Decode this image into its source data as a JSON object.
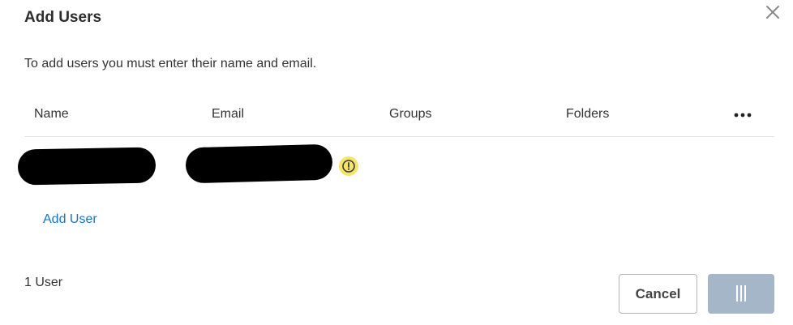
{
  "dialog": {
    "title": "Add Users",
    "instructions": "To add users you must enter their name and email."
  },
  "icons": {
    "close": "close-icon",
    "more": "more-horizontal-icon",
    "warning": "warning-icon",
    "loading": "loading-bars-icon"
  },
  "table": {
    "columns": [
      "Name",
      "Email",
      "Groups",
      "Folders"
    ],
    "rows": [
      {
        "name": "",
        "email": "",
        "groups": "",
        "folders": "",
        "status": "warning"
      }
    ]
  },
  "actions": {
    "add_user": "Add User",
    "cancel": "Cancel",
    "primary": ""
  },
  "footer": {
    "user_count": "1 User"
  },
  "colors": {
    "link": "#1a73c5",
    "warning_bg": "#f7e46b",
    "primary_disabled": "#a4b6c7"
  }
}
